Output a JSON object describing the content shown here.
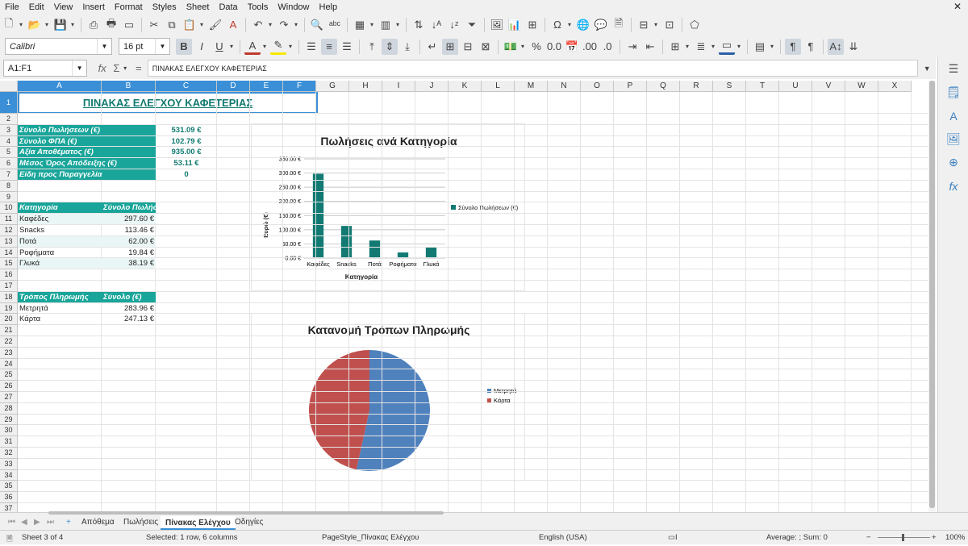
{
  "menu": [
    "File",
    "Edit",
    "View",
    "Insert",
    "Format",
    "Styles",
    "Sheet",
    "Data",
    "Tools",
    "Window",
    "Help"
  ],
  "font": {
    "name": "Calibri",
    "size": "16 pt"
  },
  "namebox": "A1:F1",
  "formula": "ΠΙΝΑΚΑΣ ΕΛΕΓΧΟΥ ΚΑΦΕΤΕΡΙΑΣ",
  "fx_labels": {
    "fx": "fx",
    "sigma": "Σ",
    "eq": "="
  },
  "columns": [
    "A",
    "B",
    "C",
    "D",
    "E",
    "F",
    "G",
    "H",
    "I",
    "J",
    "K",
    "L",
    "M",
    "N",
    "O",
    "P",
    "Q",
    "R",
    "S",
    "T",
    "U",
    "V",
    "W",
    "X"
  ],
  "rows": [
    "1",
    "2",
    "3",
    "4",
    "5",
    "6",
    "7",
    "8",
    "9",
    "10",
    "11",
    "12",
    "13",
    "14",
    "15",
    "16",
    "17",
    "18",
    "19",
    "20",
    "21",
    "22",
    "23",
    "24",
    "25",
    "26",
    "27",
    "28",
    "29",
    "30",
    "31",
    "32",
    "33",
    "34",
    "35",
    "36",
    "37"
  ],
  "sheet_title": "ΠΙΝΑΚΑΣ ΕΛΕΓΧΟΥ ΚΑΦΕΤΕΡΙΑΣ",
  "kpis": [
    {
      "label": "Σύνολο Πωλήσεων (€)",
      "value": "531.09 €"
    },
    {
      "label": "Σύνολο ΦΠΑ (€)",
      "value": "102.79 €"
    },
    {
      "label": "Αξία Αποθέματος (€)",
      "value": "935.00 €"
    },
    {
      "label": "Μέσος Όρος Απόδειξης (€)",
      "value": "53.11 €"
    },
    {
      "label": "Είδη προς Παραγγελία",
      "value": "0"
    }
  ],
  "cat_table": {
    "headers": [
      "Κατηγορία",
      "Σύνολο Πωλήσ"
    ],
    "rows": [
      [
        "Καφέδες",
        "297.60 €"
      ],
      [
        "Snacks",
        "113.46 €"
      ],
      [
        "Ποτά",
        "62.00 €"
      ],
      [
        "Ροφήματα",
        "19.84 €"
      ],
      [
        "Γλυκά",
        "38.19 €"
      ]
    ]
  },
  "pay_table": {
    "headers": [
      "Τρόπος Πληρωμής",
      "Σύνολο (€)"
    ],
    "rows": [
      [
        "Μετρητά",
        "283.96 €"
      ],
      [
        "Κάρτα",
        "247.13 €"
      ]
    ]
  },
  "chart_data": [
    {
      "type": "bar",
      "title": "Πωλήσεις ανά Κατηγορία",
      "xlabel": "Κατηγορία",
      "ylabel": "Ευρώ (€)",
      "categories": [
        "Καφέδες",
        "Snacks",
        "Ποτά",
        "Ροφήματα",
        "Γλυκά"
      ],
      "series": [
        {
          "name": "Σύνολο Πωλήσεων (€)",
          "values": [
            297.6,
            113.46,
            62.0,
            19.84,
            38.19
          ],
          "color": "#127a72"
        }
      ],
      "ylim": [
        0,
        350
      ],
      "yticks": [
        "0.00 €",
        "50.00 €",
        "100.00 €",
        "150.00 €",
        "200.00 €",
        "250.00 €",
        "300.00 €",
        "350.00 €"
      ],
      "grid": true,
      "legend": "right"
    },
    {
      "type": "pie",
      "title": "Κατανομή Τρόπων Πληρωμής",
      "labels": [
        "Μετρητά",
        "Κάρτα"
      ],
      "values": [
        283.96,
        247.13
      ],
      "colors": [
        "#4f81bd",
        "#c0504d"
      ],
      "legend": "right"
    }
  ],
  "tabs": [
    "Απόθεμα",
    "Πωλήσεις",
    "Πίνακας Ελέγχου",
    "Οδηγίες"
  ],
  "active_tab": "Πίνακας Ελέγχου",
  "status": {
    "sheet": "Sheet 3 of 4",
    "selected": "Selected: 1 row, 6 columns",
    "pagestyle": "PageStyle_Πίνακας Ελέγχου",
    "language": "English (USA)",
    "sum": "Average: ; Sum: 0",
    "zoom": "100%"
  }
}
